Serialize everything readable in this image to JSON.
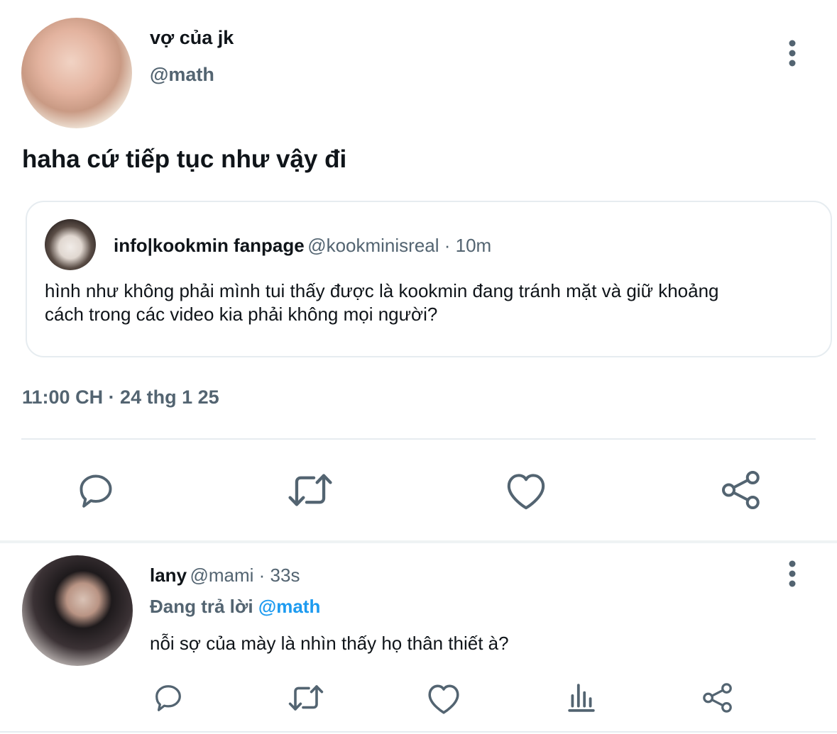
{
  "main_tweet": {
    "display_name": "vợ của jk",
    "handle": "@math",
    "text": "haha cứ tiếp tục như vậy đi",
    "timestamp": "11:00 CH · 24 thg 1 25",
    "more_icon": "more-vertical-icon"
  },
  "quoted_tweet": {
    "display_name": "info|kookmin fanpage",
    "handle": "@kookminisreal",
    "time": "10m",
    "text": "hình như không phải mình tui thấy được là kookmin đang tránh mặt và giữ khoảng cách trong các video kia phải không mọi người?"
  },
  "actions": {
    "icons": [
      "reply-icon",
      "retweet-icon",
      "like-icon",
      "share-icon"
    ]
  },
  "reply": {
    "display_name": "lany",
    "handle": "@mami",
    "time": "33s",
    "replying_prefix": "Đang trả lời",
    "replying_to": "@math",
    "text": "nỗi sợ của mày là nhìn thấy họ thân thiết à?",
    "icons": [
      "reply-icon",
      "retweet-icon",
      "like-icon",
      "analytics-icon",
      "share-icon"
    ]
  },
  "colors": {
    "icon": "#536471",
    "mention": "#1d9bf0",
    "divider": "#e6ecf0"
  },
  "dot": " · "
}
